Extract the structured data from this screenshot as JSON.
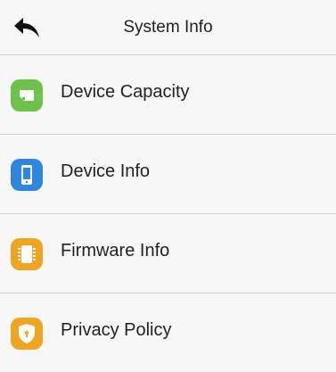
{
  "header": {
    "back_icon": "back-arrow-icon",
    "title": "System Info"
  },
  "menu": {
    "items": [
      {
        "label": "Device Capacity",
        "icon": "storage-icon",
        "color": "#6cc24a"
      },
      {
        "label": "Device Info",
        "icon": "phone-icon",
        "color": "#2e86de"
      },
      {
        "label": "Firmware Info",
        "icon": "chip-icon",
        "color": "#f0a520"
      },
      {
        "label": "Privacy Policy",
        "icon": "shield-icon",
        "color": "#f0a520"
      }
    ]
  }
}
